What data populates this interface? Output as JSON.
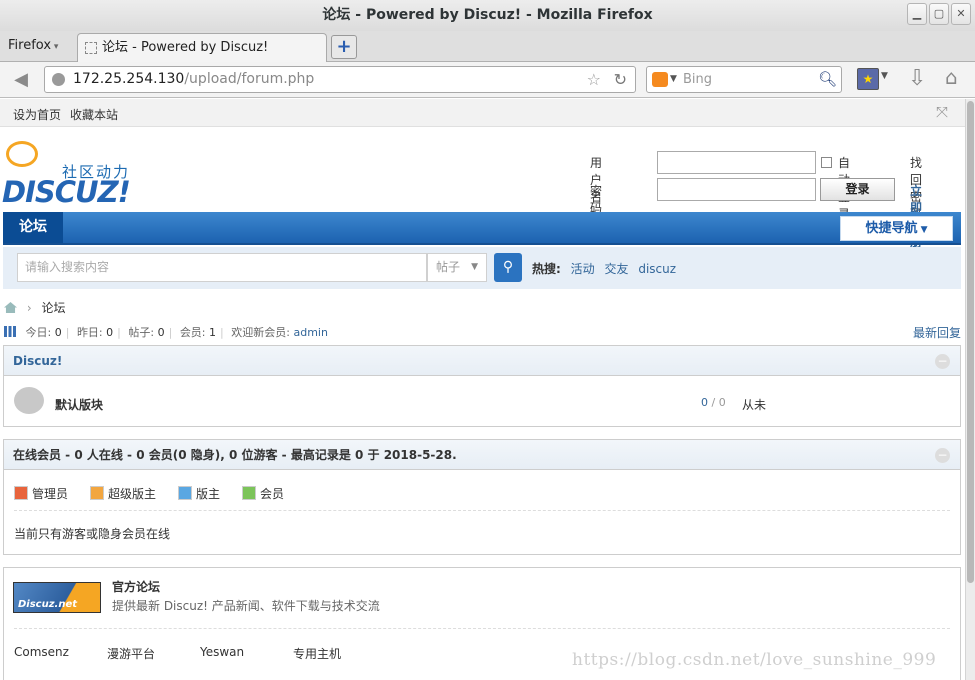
{
  "window": {
    "title": "论坛 - Powered by Discuz! - Mozilla Firefox"
  },
  "browser": {
    "menu_label": "Firefox",
    "tab_title": "论坛 - Powered by Discuz!",
    "url_host": "172.25.254.130",
    "url_path": "/upload/forum.php",
    "search_engine_placeholder": "Bing"
  },
  "topbar": {
    "set_homepage": "设为首页",
    "bookmark_site": "收藏本站"
  },
  "logo": {
    "slogan": "社区动力",
    "wordmark": "DISCUZ!"
  },
  "login": {
    "username_label": "用户名",
    "password_label": "密码",
    "auto_login": "自动登录",
    "login_button": "登录",
    "forgot_password": "找回密码",
    "register": "立即注册"
  },
  "nav": {
    "active_tab": "论坛",
    "quick_nav": "快捷导航"
  },
  "search": {
    "placeholder": "请输入搜索内容",
    "type": "帖子",
    "hot_label": "热搜:",
    "hot_terms": [
      "活动",
      "交友",
      "discuz"
    ]
  },
  "breadcrumb": {
    "current": "论坛"
  },
  "stats": {
    "today_label": "今日:",
    "today": "0",
    "yesterday_label": "昨日:",
    "yesterday": "0",
    "posts_label": "帖子:",
    "posts": "0",
    "members_label": "会员:",
    "members": "1",
    "welcome": "欢迎新会员:",
    "newest_member": "admin",
    "latest_replies": "最新回复"
  },
  "category": {
    "title": "Discuz!",
    "forums": [
      {
        "name": "默认版块",
        "threads": "0",
        "posts": "0",
        "last_post": "从未"
      }
    ]
  },
  "online": {
    "title": "在线会员 - 0 人在线 - 0 会员(0 隐身), 0 位游客 - 最高记录是 0 于 2018-5-28.",
    "legend": [
      "管理员",
      "超级版主",
      "版主",
      "会员"
    ],
    "empty_message": "当前只有游客或隐身会员在线"
  },
  "links": {
    "official_title": "官方论坛",
    "official_desc": "提供最新 Discuz! 产品新闻、软件下载与技术交流",
    "banner_text": "Discuz.net",
    "partners": [
      "Comsenz",
      "漫游平台",
      "Yeswan",
      "专用主机"
    ]
  },
  "watermark": "https://blog.csdn.net/love_sunshine_999",
  "colors": {
    "nav_blue": "#1c62b0",
    "link_blue": "#336699",
    "logo_orange": "#f5a623"
  }
}
